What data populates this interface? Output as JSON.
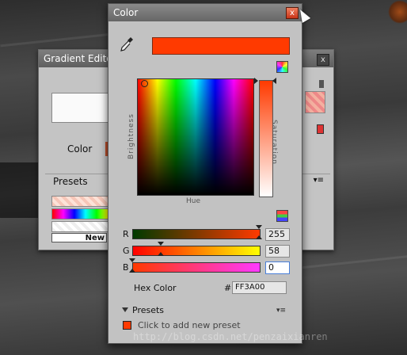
{
  "background": {
    "bg_dark": "#2d2d2d"
  },
  "gradient_editor": {
    "title": "Gradient Editor",
    "close_label": "x",
    "color_label": "Color",
    "presets_label": "Presets",
    "new_label": "New",
    "menu_glyph": "▾≡"
  },
  "color_window": {
    "title": "Color",
    "close_label": "x",
    "current_color": "#FF3A00",
    "icons": [
      "eyedropper-icon",
      "color-mode-icon",
      "slider-mode-icon"
    ],
    "field_labels": {
      "brightness": "Brightness",
      "saturation": "Saturation",
      "hue": "Hue"
    },
    "sliders": [
      {
        "label": "R",
        "value": "255",
        "fraction": 1.0
      },
      {
        "label": "G",
        "value": "58",
        "fraction": 0.227
      },
      {
        "label": "B",
        "value": "0",
        "fraction": 0.0
      }
    ],
    "hex_label": "Hex Color",
    "hash": "#",
    "hex_value": "FF3A00",
    "presets_label": "Presets",
    "presets_menu": "▾≡",
    "add_preset": "Click to add new preset"
  },
  "watermark": "http://blog.csdn.net/penzaixianren"
}
